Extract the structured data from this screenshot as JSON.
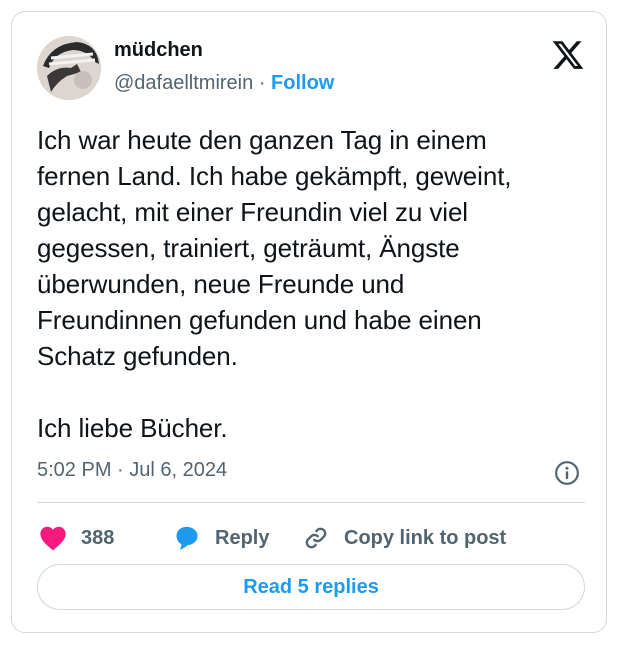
{
  "author": {
    "name": "müdchen",
    "handle": "@dafaelltmirein",
    "separator": "·",
    "follow_label": "Follow"
  },
  "icons": {
    "logo": "x-logo-icon",
    "info": "info-icon",
    "like": "heart-icon",
    "reply": "speech-bubble-icon",
    "copy": "link-icon"
  },
  "post": {
    "text": "Ich war heute den ganzen Tag in einem\nfernen Land. Ich habe gekämpft, geweint,\ngelacht, mit einer Freundin viel zu viel\ngegessen, trainiert, geträumt, Ängste\nüberwunden, neue Freunde und\nFreundinnen gefunden und habe einen\nSchatz gefunden.\n\nIch liebe Bücher.",
    "timestamp": "5:02 PM · Jul 6, 2024"
  },
  "actions": {
    "like_count": "388",
    "reply_label": "Reply",
    "copy_label": "Copy link to post"
  },
  "replies_button": "Read 5 replies",
  "colors": {
    "accent": "#1d9bf0",
    "like": "#f91880",
    "text": "#0f1419",
    "muted": "#536471",
    "border": "#cfd9de"
  }
}
